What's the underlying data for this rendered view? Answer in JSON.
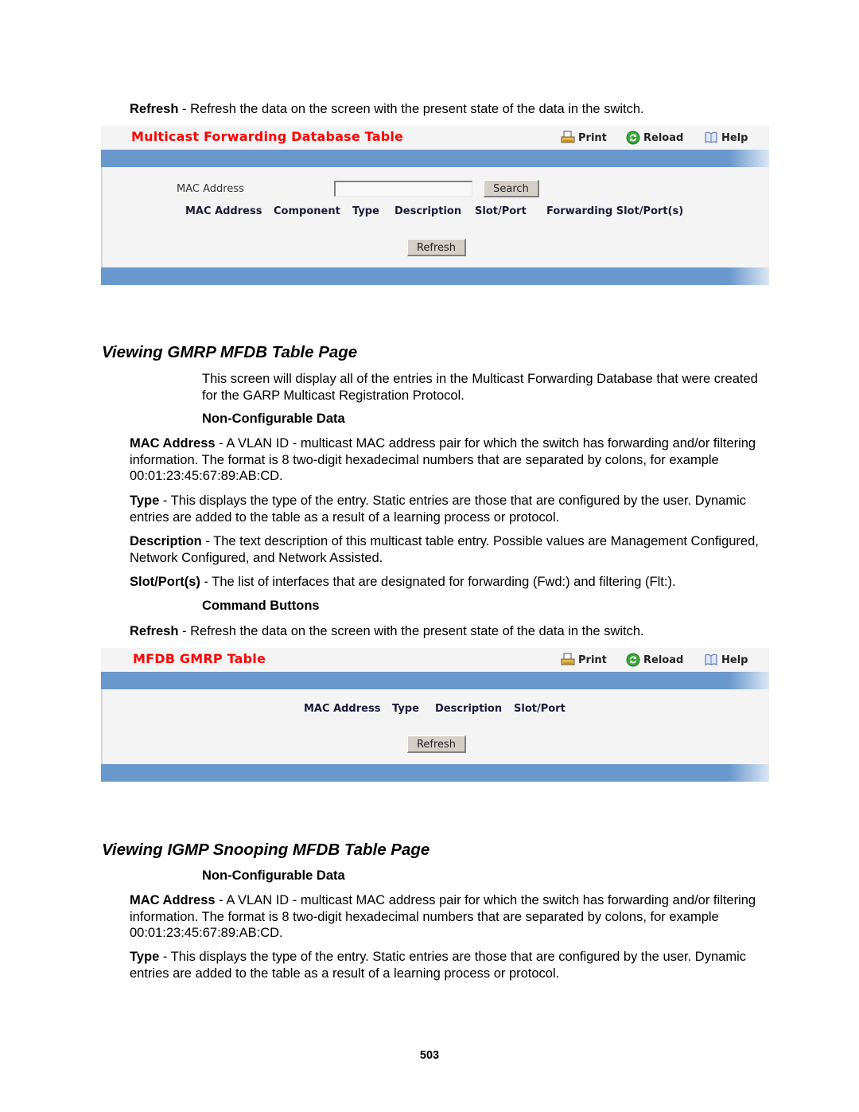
{
  "top_refresh_para": {
    "term": "Refresh",
    "text": " - Refresh the data on the screen with the present state of the data in the switch."
  },
  "panel1": {
    "title": "Multicast Forwarding Database Table",
    "toolbar": {
      "print": "Print",
      "reload": "Reload",
      "help": "Help"
    },
    "search_label": "MAC Address",
    "search_input": {
      "value": "",
      "placeholder": ""
    },
    "search_button": "Search",
    "columns": [
      "MAC Address",
      "Component",
      "Type",
      "Description",
      "Slot/Port",
      "Forwarding Slot/Port(s)"
    ],
    "refresh_button": "Refresh"
  },
  "section_gmrp": {
    "title": "Viewing GMRP MFDB Table Page",
    "intro": "This screen will display all of the entries in the Multicast Forwarding Database that were created for the GARP Multicast Registration Protocol.",
    "noncfg_heading": "Non-Configurable Data",
    "items": [
      {
        "term": "MAC Address",
        "text": " - A VLAN ID - multicast MAC address pair for which the switch has forwarding and/or filtering information. The format is 8 two-digit hexadecimal numbers that are separated by colons, for example 00:01:23:45:67:89:AB:CD."
      },
      {
        "term": "Type",
        "text": " - This displays the type of the entry. Static entries are those that are configured by the user. Dynamic entries are added to the table as a result of a learning process or protocol."
      },
      {
        "term": "Description",
        "text": " - The text description of this multicast table entry. Possible values are Management Configured, Network Configured, and Network Assisted."
      },
      {
        "term": "Slot/Port(s)",
        "text": " - The list of interfaces that are designated for forwarding (Fwd:) and filtering (Flt:)."
      }
    ],
    "cmd_heading": "Command Buttons",
    "refresh": {
      "term": "Refresh",
      "text": " - Refresh the data on the screen with the present state of the data in the switch."
    }
  },
  "panel2": {
    "title": "MFDB GMRP Table",
    "toolbar": {
      "print": "Print",
      "reload": "Reload",
      "help": "Help"
    },
    "columns": [
      "MAC Address",
      "Type",
      "Description",
      "Slot/Port"
    ],
    "refresh_button": "Refresh"
  },
  "section_igmp": {
    "title": "Viewing IGMP Snooping MFDB Table Page",
    "noncfg_heading": "Non-Configurable Data",
    "items": [
      {
        "term": "MAC Address",
        "text": " - A VLAN ID - multicast MAC address pair for which the switch has forwarding and/or filtering information. The format is 8 two-digit hexadecimal numbers that are separated by colons, for example 00:01:23:45:67:89:AB:CD."
      },
      {
        "term": "Type",
        "text": " - This displays the type of the entry. Static entries are those that are configured by the user. Dynamic entries are added to the table as a result of a learning process or protocol."
      }
    ]
  },
  "page_number": "503",
  "colors": {
    "title_red": "#ff0000",
    "bar_blue": "#6998cc",
    "panel_bg": "#f4f4f4"
  }
}
